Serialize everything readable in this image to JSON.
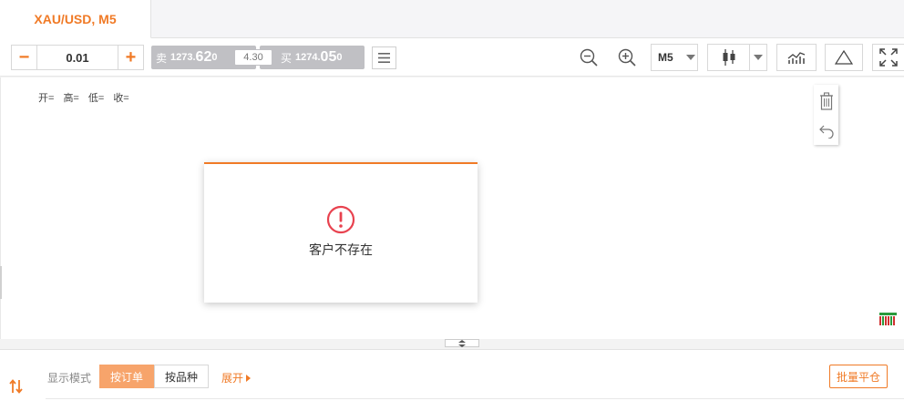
{
  "tab": {
    "title": "XAU/USD, M5"
  },
  "toolbar": {
    "lot": {
      "minus": "−",
      "value": "0.01",
      "plus": "+"
    },
    "sell": {
      "label": "卖",
      "price_small": "1273.",
      "price_big": "62",
      "price_tail": "0"
    },
    "spread": "4.30",
    "buy": {
      "label": "买",
      "price_small": "1274.",
      "price_big": "05",
      "price_tail": "0"
    },
    "timeframe": "M5"
  },
  "chart": {
    "ohlc": {
      "open": "开=",
      "high": "高=",
      "low": "低=",
      "close": "收="
    }
  },
  "dialog": {
    "message": "客户不存在"
  },
  "bottom": {
    "display_mode_label": "显示模式",
    "by_order": "按订单",
    "by_symbol": "按品种",
    "expand": "展开",
    "batch_close": "批量平仓"
  },
  "colors": {
    "accent": "#f07a26",
    "error": "#e8424f",
    "quote_bg": "#c0c0c4"
  }
}
